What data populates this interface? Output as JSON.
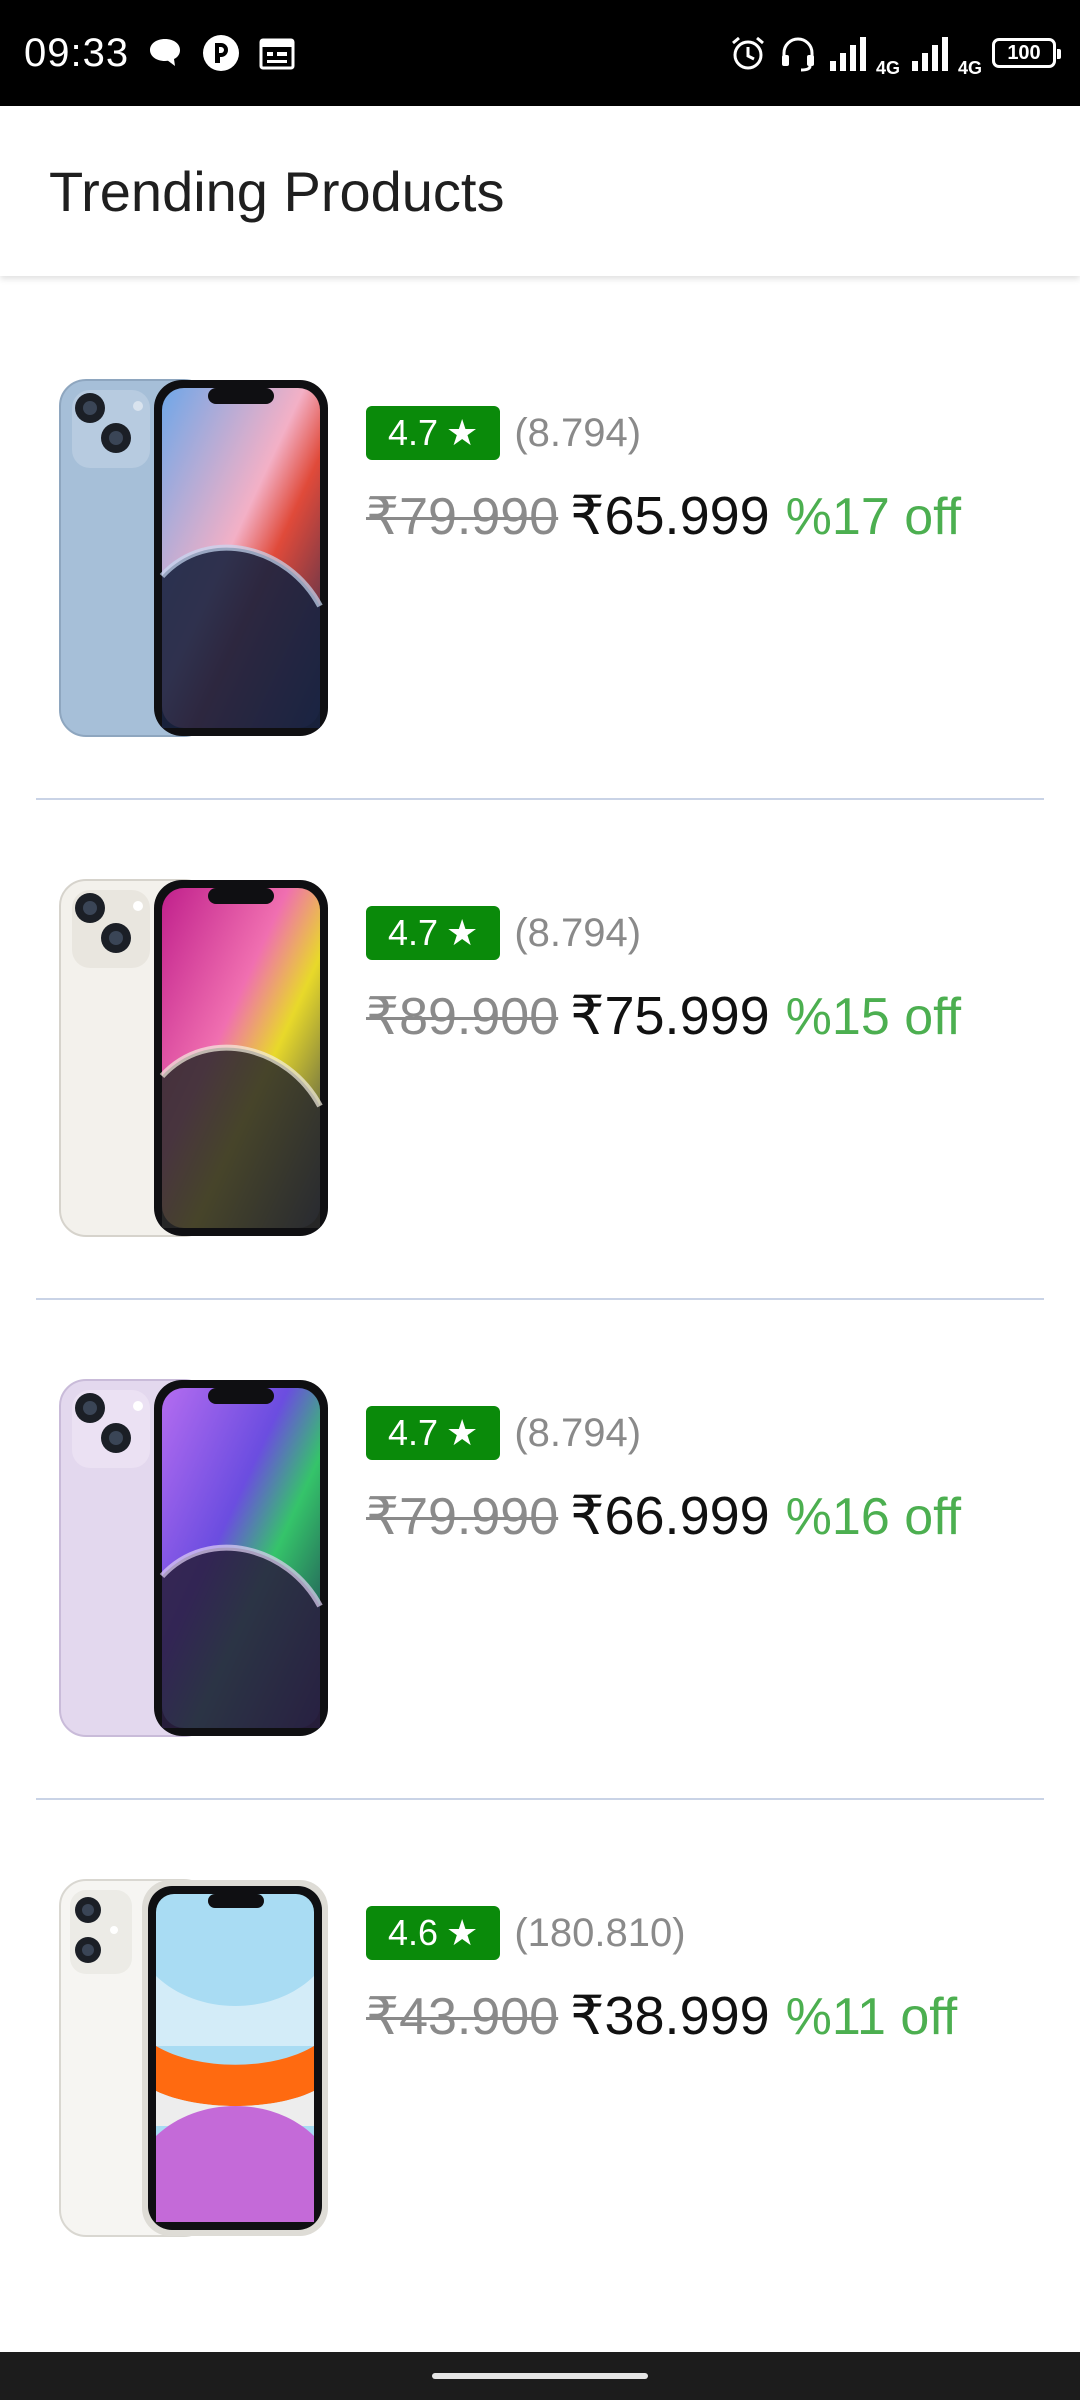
{
  "status_bar": {
    "time": "09:33",
    "network_1": "4G",
    "network_2": "4G",
    "battery": "100",
    "icons": [
      "chat-bubble-icon",
      "app-notification-icon",
      "calendar-icon",
      "alarm-icon",
      "headset-icon",
      "signal-strength-icon",
      "battery-icon"
    ]
  },
  "app_bar": {
    "title": "Trending Products"
  },
  "products": [
    {
      "rating": "4.7",
      "rating_count": "(8.794)",
      "original_price": "₹79.990",
      "sale_price": "₹65.999",
      "discount": "%17 off"
    },
    {
      "rating": "4.7",
      "rating_count": "(8.794)",
      "original_price": "₹89.900",
      "sale_price": "₹75.999",
      "discount": "%15 off"
    },
    {
      "rating": "4.7",
      "rating_count": "(8.794)",
      "original_price": "₹79.990",
      "sale_price": "₹66.999",
      "discount": "%16 off"
    },
    {
      "rating": "4.6",
      "rating_count": "(180.810)",
      "original_price": "₹43.900",
      "sale_price": "₹38.999",
      "discount": "%11 off"
    }
  ],
  "colors": {
    "rating_badge": "#0a8a0a",
    "discount": "#4caf50",
    "old_price": "#8a8a8a",
    "divider": "#c9d3e6",
    "status_bar": "#000000"
  }
}
